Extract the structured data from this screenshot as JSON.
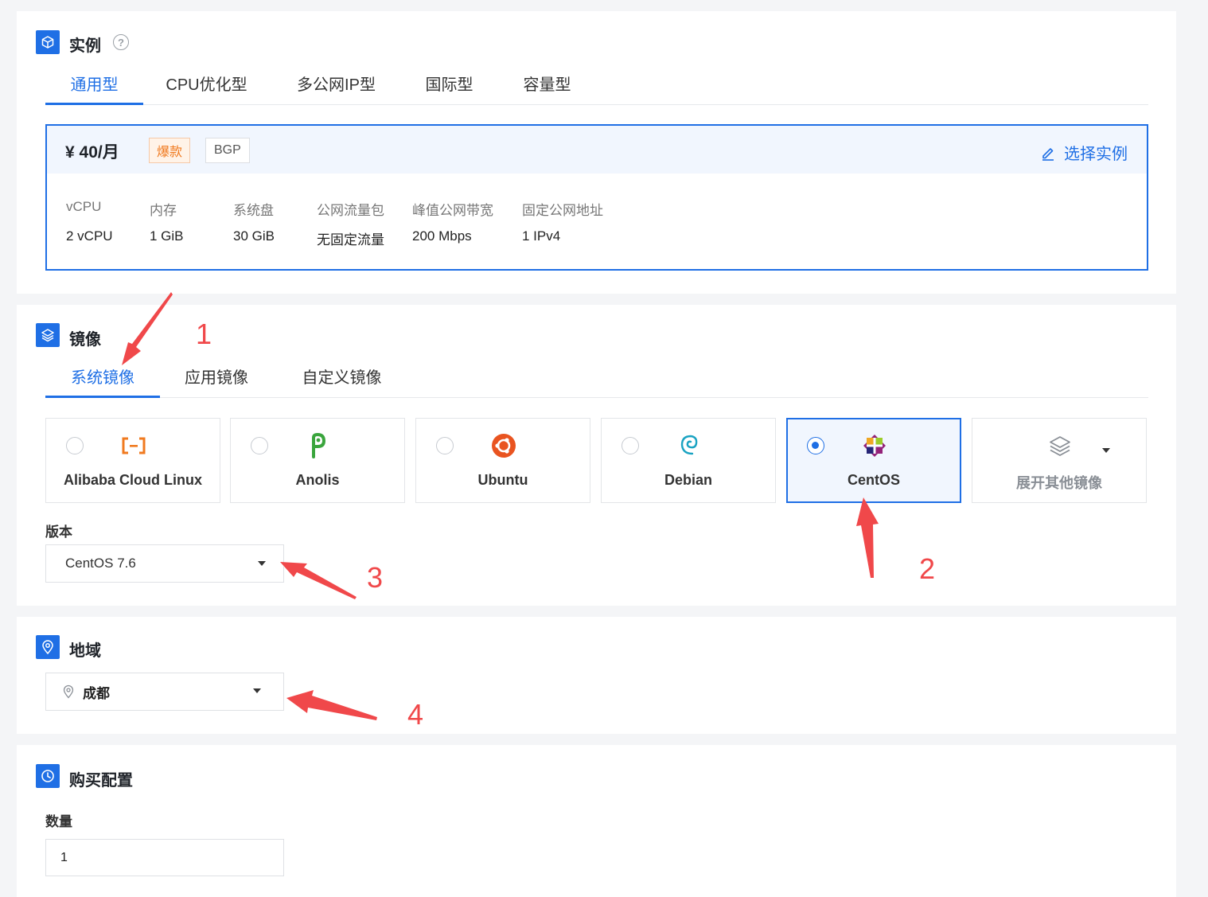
{
  "instance": {
    "title": "实例",
    "help_icon": "question-circle-icon",
    "tabs": [
      "通用型",
      "CPU优化型",
      "多公网IP型",
      "国际型",
      "容量型"
    ],
    "active_tab": "通用型",
    "price": "¥ 40/月",
    "tag_hot": "爆款",
    "tag_bgp": "BGP",
    "select_label": "选择实例",
    "specs": [
      {
        "label": "vCPU",
        "value": "2 vCPU"
      },
      {
        "label": "内存",
        "value": "1 GiB"
      },
      {
        "label": "系统盘",
        "value": "30 GiB"
      },
      {
        "label": "公网流量包",
        "value": "无固定流量"
      },
      {
        "label": "峰值公网带宽",
        "value": "200 Mbps"
      },
      {
        "label": "固定公网地址",
        "value": "1 IPv4"
      }
    ]
  },
  "image": {
    "title": "镜像",
    "tabs": [
      "系统镜像",
      "应用镜像",
      "自定义镜像"
    ],
    "active_tab": "系统镜像",
    "os_options": [
      {
        "name": "Alibaba Cloud Linux",
        "icon": "alibaba-cloud-icon",
        "selected": false
      },
      {
        "name": "Anolis",
        "icon": "anolis-icon",
        "selected": false
      },
      {
        "name": "Ubuntu",
        "icon": "ubuntu-icon",
        "selected": false
      },
      {
        "name": "Debian",
        "icon": "debian-icon",
        "selected": false
      },
      {
        "name": "CentOS",
        "icon": "centos-icon",
        "selected": true
      }
    ],
    "more_label": "展开其他镜像",
    "version_label": "版本",
    "version_value": "CentOS 7.6"
  },
  "region": {
    "title": "地域",
    "value": "成都"
  },
  "purchase": {
    "title": "购买配置",
    "quantity_label": "数量",
    "quantity_value": "1"
  },
  "annotations": [
    "1",
    "2",
    "3",
    "4"
  ],
  "colors": {
    "accent": "#1f6fe5",
    "annotation": "#f0484a",
    "hot": "#f07a1f"
  }
}
